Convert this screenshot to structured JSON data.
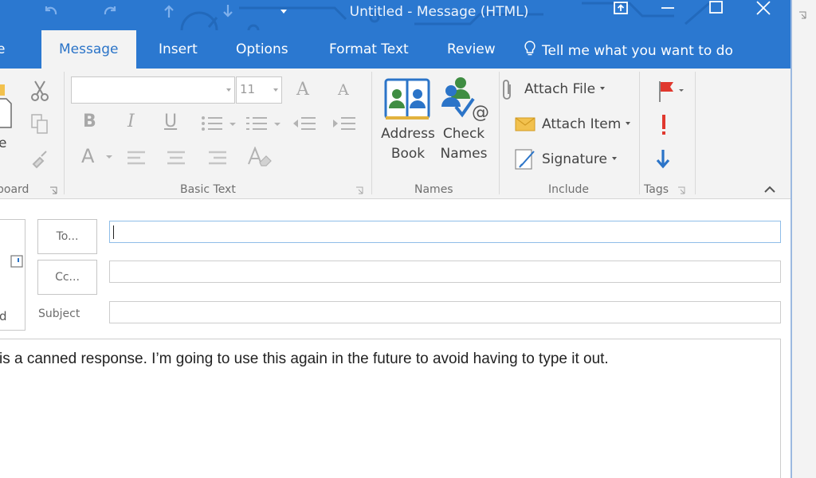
{
  "window": {
    "title": "Untitled  -  Message (HTML)"
  },
  "tabs": {
    "file_partial": "e",
    "message": "Message",
    "insert": "Insert",
    "options": "Options",
    "format_text": "Format Text",
    "review": "Review",
    "tell_me": "Tell me what you want to do"
  },
  "ribbon": {
    "clipboard": {
      "label": "board",
      "paste_partial": "e"
    },
    "basic_text": {
      "label": "Basic Text",
      "font_name": "",
      "font_size": "11",
      "glyph_grow": "A",
      "glyph_shrink": "A",
      "bold": "B",
      "italic": "I",
      "underline": "U",
      "font_color": "A"
    },
    "names": {
      "label": "Names",
      "address_book_line1": "Address",
      "address_book_line2": "Book",
      "check_names_line1": "Check",
      "check_names_line2": "Names"
    },
    "include": {
      "label": "Include",
      "attach_file": "Attach File",
      "attach_item": "Attach Item",
      "signature": "Signature"
    },
    "tags": {
      "label": "Tags"
    }
  },
  "compose": {
    "send_partial": "d",
    "to_button": "To...",
    "cc_button": "Cc...",
    "subject_label": "Subject",
    "to_value": "",
    "cc_value": "",
    "subject_value": "",
    "body_text": "is a canned response. I’m going to use this again in the future to avoid having to type it out."
  },
  "colors": {
    "accent": "#2b78d0",
    "ribbon_bg": "#f3f3f3",
    "flag_red": "#e0382e",
    "arrow_blue": "#2b74c8"
  }
}
